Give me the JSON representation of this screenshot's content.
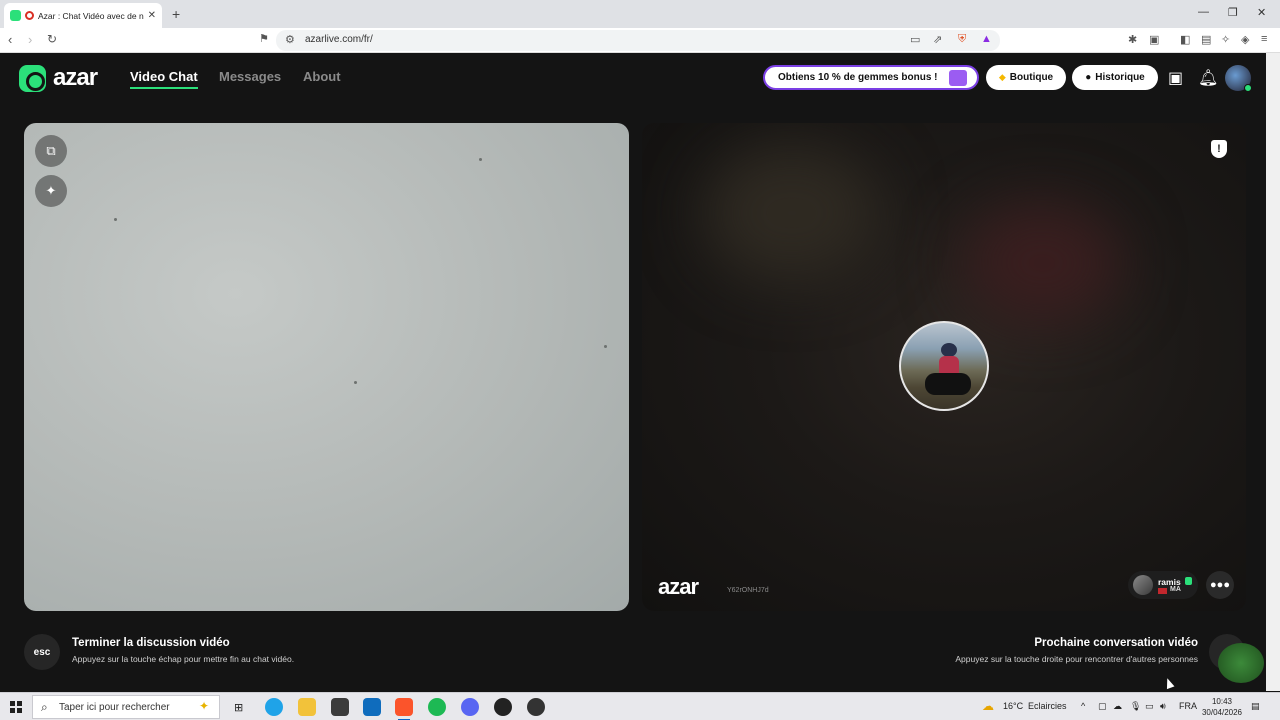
{
  "browser": {
    "tab_title": "Azar : Chat Vidéo avec de no",
    "new_tab": "+",
    "url": "azarlive.com/fr/",
    "win_min": "—",
    "win_max": "❐",
    "win_close": "✕"
  },
  "header": {
    "logo_text": "azar",
    "nav": [
      "Video Chat",
      "Messages",
      "About"
    ],
    "promo_label": "Obtiens 10 % de gemmes bonus !",
    "shop_label": "Boutique",
    "history_label": "Historique"
  },
  "video": {
    "watermark": "azar",
    "session_id": "Y62rONHJ7d",
    "partner_name": "ramis",
    "partner_country": "MA"
  },
  "footer": {
    "esc_key": "esc",
    "end_title": "Terminer la discussion vidéo",
    "end_subtitle": "Appuyez sur la touche échap pour mettre fin au chat vidéo.",
    "next_title": "Prochaine conversation vidéo",
    "next_subtitle": "Appuyez sur la touche droite pour rencontrer d'autres personnes"
  },
  "taskbar": {
    "search_placeholder": "Taper ici pour rechercher",
    "weather_temp": "16°C",
    "weather_desc": "Eclaircies",
    "language": "FRA",
    "time": "10:43",
    "date": "30/04/2026"
  },
  "colors": {
    "brand_green": "#2be07a",
    "promo_border": "#7b3fe4",
    "app_background": "#141414"
  }
}
